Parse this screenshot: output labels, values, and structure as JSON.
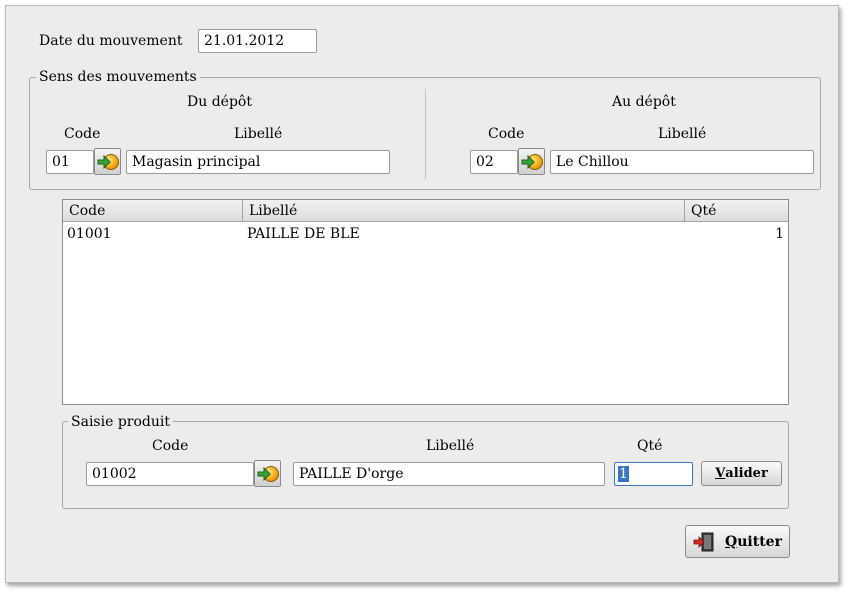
{
  "header": {
    "date_label": "Date du mouvement",
    "date_value": "21.01.2012"
  },
  "sens": {
    "title": "Sens des mouvements",
    "from": {
      "title": "Du dépôt",
      "code_label": "Code",
      "libelle_label": "Libellé",
      "code_value": "01",
      "libelle_value": "Magasin principal"
    },
    "to": {
      "title": "Au dépôt",
      "code_label": "Code",
      "libelle_label": "Libellé",
      "code_value": "02",
      "libelle_value": "Le Chillou"
    }
  },
  "table": {
    "columns": [
      "Code",
      "Libellé",
      "Qté"
    ],
    "rows": [
      {
        "code": "01001",
        "libelle": "PAILLE DE BLE",
        "qte": "1"
      }
    ]
  },
  "saisie": {
    "title": "Saisie produit",
    "code_label": "Code",
    "libelle_label": "Libellé",
    "qte_label": "Qté",
    "code_value": "01002",
    "libelle_value": "PAILLE D'orge",
    "qte_value": "1",
    "valider_first": "V",
    "valider_rest": "alider"
  },
  "footer": {
    "quit_first": "Q",
    "quit_rest": "uitter"
  },
  "icons": {
    "lookup": "lookup-go-icon",
    "quit": "exit-door-icon"
  },
  "colors": {
    "window_bg": "#ececec",
    "accent_focus": "#3a75c4",
    "lookup_disc": "#f2a60c",
    "lookup_arrow": "#3aa33a"
  }
}
